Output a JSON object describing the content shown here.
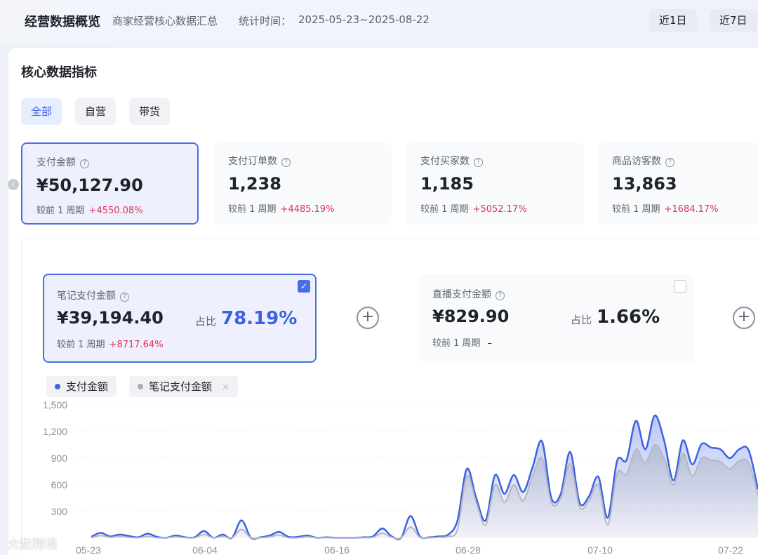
{
  "header": {
    "title": "经营数据概览",
    "subtitle": "商家经营核心数据汇总",
    "time_label": "统计时间：",
    "time_range": "2025-05-23~2025-08-22",
    "range_buttons": [
      "近1日",
      "近7日"
    ]
  },
  "section": {
    "title": "核心数据指标",
    "tabs": [
      {
        "label": "全部",
        "active": true
      },
      {
        "label": "自营",
        "active": false
      },
      {
        "label": "带货",
        "active": false
      }
    ]
  },
  "metrics": [
    {
      "label": "支付金额",
      "value": "¥50,127.90",
      "compare_label": "较前 1 周期",
      "compare_value": "+4550.08%"
    },
    {
      "label": "支付订单数",
      "value": "1,238",
      "compare_label": "较前 1 周期",
      "compare_value": "+4485.19%"
    },
    {
      "label": "支付买家数",
      "value": "1,185",
      "compare_label": "较前 1 周期",
      "compare_value": "+5052.17%"
    },
    {
      "label": "商品访客数",
      "value": "13,863",
      "compare_label": "较前 1 周期",
      "compare_value": "+1684.17%"
    }
  ],
  "sub_metrics": [
    {
      "label": "笔记支付金额",
      "value": "¥39,194.40",
      "ratio_label": "占比",
      "ratio": "78.19%",
      "compare_label": "较前 1 周期",
      "compare_value": "+8717.64%",
      "checked": true
    },
    {
      "label": "直播支付金额",
      "value": "¥829.90",
      "ratio_label": "占比",
      "ratio": "1.66%",
      "compare_label": "较前 1 周期",
      "compare_value": "–",
      "checked": false
    }
  ],
  "legend": [
    {
      "name": "支付金额",
      "color": "#3d63e0"
    },
    {
      "name": "笔记支付金额",
      "color": "#a9adb6"
    }
  ],
  "watermark": "大数跨境",
  "colors": {
    "accent": "#3d63e0",
    "positive": "#e0315e",
    "secondary_series": "#a9adb6"
  },
  "chart_data": {
    "type": "area",
    "yticks": [
      300,
      600,
      900,
      1200,
      1500
    ],
    "ylim": [
      0,
      1500
    ],
    "xticks": [
      "05-23",
      "06-04",
      "06-16",
      "06-28",
      "07-10",
      "07-22"
    ],
    "series": [
      {
        "name": "支付金额",
        "values": [
          15,
          60,
          20,
          40,
          25,
          10,
          50,
          15,
          5,
          30,
          10,
          10,
          80,
          5,
          40,
          5,
          200,
          5,
          10,
          30,
          70,
          15,
          15,
          30,
          5,
          10,
          5,
          5,
          5,
          10,
          20,
          110,
          20,
          5,
          250,
          20,
          10,
          20,
          40,
          200,
          780,
          450,
          200,
          710,
          500,
          710,
          520,
          800,
          1090,
          450,
          500,
          970,
          400,
          470,
          690,
          230,
          870,
          880,
          1320,
          1000,
          1380,
          1100,
          650,
          1100,
          830,
          1060,
          1020,
          1000,
          900,
          1000,
          990,
          550
        ]
      },
      {
        "name": "笔记支付金额",
        "values": [
          5,
          30,
          10,
          20,
          10,
          5,
          20,
          5,
          5,
          15,
          5,
          5,
          40,
          5,
          20,
          5,
          100,
          5,
          5,
          15,
          35,
          5,
          5,
          15,
          5,
          5,
          5,
          5,
          5,
          5,
          10,
          55,
          10,
          5,
          125,
          10,
          5,
          10,
          20,
          100,
          700,
          400,
          150,
          600,
          400,
          600,
          420,
          700,
          900,
          400,
          450,
          840,
          350,
          420,
          600,
          150,
          730,
          720,
          1000,
          850,
          1050,
          900,
          600,
          950,
          700,
          900,
          880,
          860,
          780,
          870,
          850,
          480
        ]
      }
    ]
  }
}
